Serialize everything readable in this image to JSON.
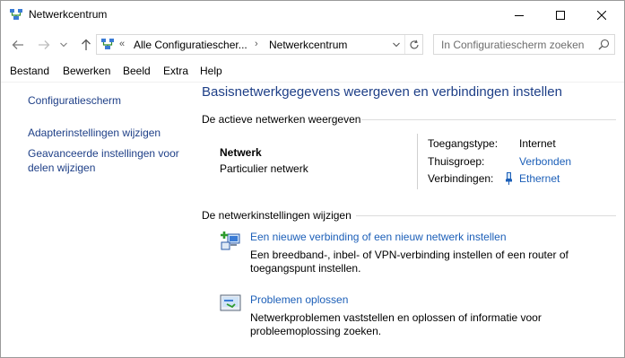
{
  "window": {
    "title": "Netwerkcentrum"
  },
  "nav": {
    "breadcrumb_overflow": "«",
    "crumbs": [
      "Alle Configuratiescher...",
      "Netwerkcentrum"
    ],
    "search_placeholder": "In Configuratiescherm zoeken"
  },
  "menu": [
    "Bestand",
    "Bewerken",
    "Beeld",
    "Extra",
    "Help"
  ],
  "sidebar": {
    "home": "Configuratiescherm",
    "links": [
      "Adapterinstellingen wijzigen",
      "Geavanceerde instellingen voor delen wijzigen"
    ]
  },
  "main": {
    "title": "Basisnetwerkgegevens weergeven en verbindingen instellen",
    "active_heading": "De actieve netwerken weergeven",
    "network": {
      "name": "Netwerk",
      "category": "Particulier netwerk",
      "props": [
        {
          "label": "Toegangstype:",
          "value": "Internet",
          "link": false
        },
        {
          "label": "Thuisgroep:",
          "value": "Verbonden",
          "link": true
        },
        {
          "label": "Verbindingen:",
          "value": "Ethernet",
          "link": true
        }
      ]
    },
    "settings_heading": "De netwerkinstellingen wijzigen",
    "tasks": [
      {
        "link": "Een nieuwe verbinding of een nieuw netwerk instellen",
        "desc": "Een breedband-, inbel- of VPN-verbinding instellen of een router of toegangspunt instellen."
      },
      {
        "link": "Problemen oplossen",
        "desc": "Netwerkproblemen vaststellen en oplossen of informatie voor probleemoplossing zoeken."
      }
    ]
  },
  "colors": {
    "heading_blue": "#1e3f87",
    "link_blue": "#1c5fb8"
  }
}
